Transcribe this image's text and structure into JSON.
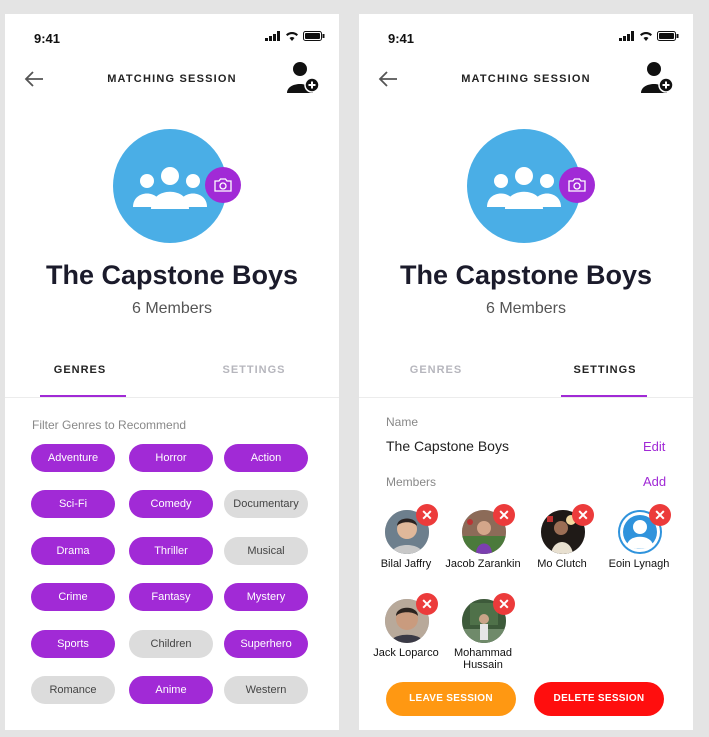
{
  "colors": {
    "accent": "#a12ad6",
    "avatar_bg": "#4aaee6",
    "leave": "#ff9812",
    "delete": "#ff0e0e",
    "remove": "#ec3b3b",
    "chip_off": "#dcdcdc"
  },
  "left": {
    "time": "9:41",
    "title": "MATCHING SESSION",
    "group_name": "The Capstone Boys",
    "members_label": "6 Members",
    "tabs": [
      {
        "label": "GENRES",
        "active": true
      },
      {
        "label": "SETTINGS",
        "active": false
      }
    ],
    "filter_label": "Filter Genres to Recommend",
    "genres": [
      {
        "label": "Adventure",
        "selected": true
      },
      {
        "label": "Horror",
        "selected": true
      },
      {
        "label": "Action",
        "selected": true
      },
      {
        "label": "Sci-Fi",
        "selected": true
      },
      {
        "label": "Comedy",
        "selected": true
      },
      {
        "label": "Documentary",
        "selected": false
      },
      {
        "label": "Drama",
        "selected": true
      },
      {
        "label": "Thriller",
        "selected": true
      },
      {
        "label": "Musical",
        "selected": false
      },
      {
        "label": "Crime",
        "selected": true
      },
      {
        "label": "Fantasy",
        "selected": true
      },
      {
        "label": "Mystery",
        "selected": true
      },
      {
        "label": "Sports",
        "selected": true
      },
      {
        "label": "Children",
        "selected": false
      },
      {
        "label": "Superhero",
        "selected": true
      },
      {
        "label": "Romance",
        "selected": false
      },
      {
        "label": "Anime",
        "selected": true
      },
      {
        "label": "Western",
        "selected": false
      }
    ]
  },
  "right": {
    "time": "9:41",
    "title": "MATCHING SESSION",
    "group_name": "The Capstone Boys",
    "members_label": "6 Members",
    "tabs": [
      {
        "label": "GENRES",
        "active": false
      },
      {
        "label": "SETTINGS",
        "active": true
      }
    ],
    "name_label": "Name",
    "name_value": "The Capstone Boys",
    "edit_label": "Edit",
    "members_section_label": "Members",
    "add_label": "Add",
    "members": [
      {
        "name": "Bilal Jaffry",
        "photo": "photo"
      },
      {
        "name": "Jacob Zarankin",
        "photo": "photo"
      },
      {
        "name": "Mo Clutch",
        "photo": "photo"
      },
      {
        "name": "Eoin Lynagh",
        "photo": "default-avatar"
      },
      {
        "name": "Jack Loparco",
        "photo": "photo"
      },
      {
        "name": "Mohammad Hussain",
        "photo": "photo"
      }
    ],
    "remove_icon": "close-icon",
    "leave_label": "LEAVE SESSION",
    "delete_label": "DELETE SESSION"
  }
}
